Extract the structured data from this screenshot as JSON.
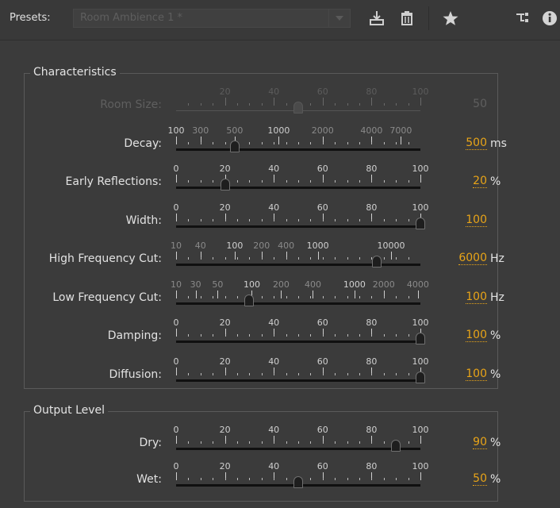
{
  "presets": {
    "label": "Presets:",
    "selected": "Room Ambience 1 *"
  },
  "toolbar": {
    "icons": [
      "save-preset-icon",
      "delete-preset-icon",
      "favorite-star-icon",
      "routing-icon",
      "info-icon"
    ]
  },
  "characteristics": {
    "title": "Characteristics",
    "rows": [
      {
        "label": "Room Size:",
        "value": "50",
        "unit": "",
        "disabled": true,
        "ticks": [
          "20",
          "40",
          "60",
          "80",
          "100"
        ],
        "slider_position": 0.5
      },
      {
        "label": "Decay:",
        "value": "500",
        "unit": "ms",
        "disabled": false,
        "ticks": [
          "100",
          "300",
          "500",
          "1000",
          "2000",
          "4000",
          "7000"
        ],
        "slider_position": 0.24
      },
      {
        "label": "Early Reflections:",
        "value": "20",
        "unit": "%",
        "disabled": false,
        "ticks": [
          "0",
          "20",
          "40",
          "60",
          "80",
          "100"
        ],
        "slider_position": 0.2
      },
      {
        "label": "Width:",
        "value": "100",
        "unit": "",
        "disabled": false,
        "ticks": [
          "0",
          "20",
          "40",
          "60",
          "80",
          "100"
        ],
        "slider_position": 1.0
      },
      {
        "label": "High Frequency Cut:",
        "value": "6000",
        "unit": "Hz",
        "disabled": false,
        "ticks": [
          "10",
          "40",
          "100",
          "200",
          "400",
          "1000",
          "10000"
        ],
        "slider_position": 0.82
      },
      {
        "label": "Low Frequency Cut:",
        "value": "100",
        "unit": "Hz",
        "disabled": false,
        "ticks": [
          "10",
          "30",
          "50",
          "100",
          "200",
          "400",
          "1000",
          "2000",
          "4000"
        ],
        "slider_position": 0.3
      },
      {
        "label": "Damping:",
        "value": "100",
        "unit": "%",
        "disabled": false,
        "ticks": [
          "0",
          "20",
          "40",
          "60",
          "80",
          "100"
        ],
        "slider_position": 1.0
      },
      {
        "label": "Diffusion:",
        "value": "100",
        "unit": "%",
        "disabled": false,
        "ticks": [
          "0",
          "20",
          "40",
          "60",
          "80",
          "100"
        ],
        "slider_position": 1.0
      }
    ]
  },
  "output_level": {
    "title": "Output Level",
    "rows": [
      {
        "label": "Dry:",
        "value": "90",
        "unit": "%",
        "disabled": false,
        "ticks": [
          "0",
          "20",
          "40",
          "60",
          "80",
          "100"
        ],
        "slider_position": 0.9
      },
      {
        "label": "Wet:",
        "value": "50",
        "unit": "%",
        "disabled": false,
        "ticks": [
          "0",
          "20",
          "40",
          "60",
          "80",
          "100"
        ],
        "slider_position": 0.5
      }
    ]
  },
  "colors": {
    "value_accent": "#e8a418",
    "background": "#3b3b3b",
    "track": "#101010"
  }
}
